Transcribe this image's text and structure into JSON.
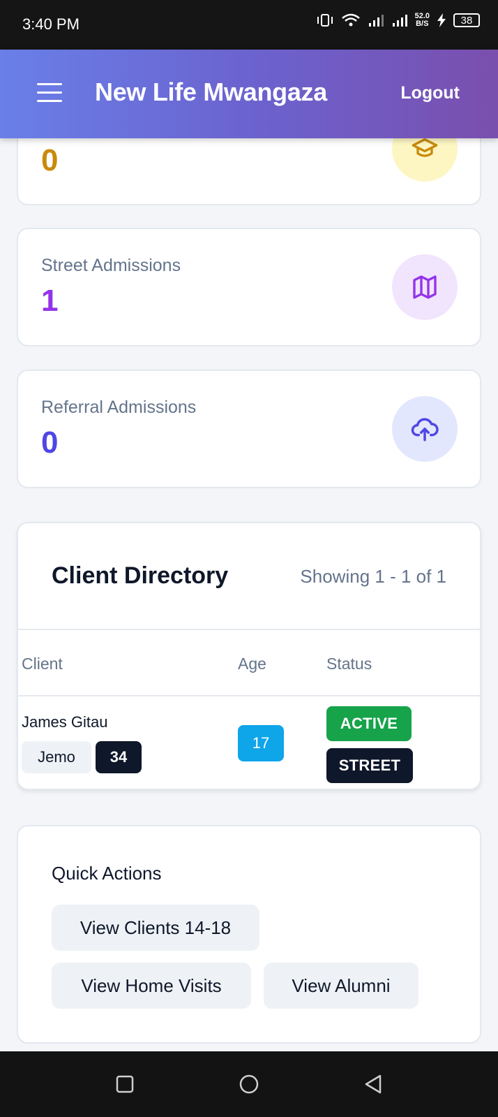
{
  "status_bar": {
    "time": "3:40 PM",
    "net_speed_value": "52.0",
    "net_speed_unit": "B/S",
    "battery": "38"
  },
  "header": {
    "title": "New Life Mwangaza",
    "logout_label": "Logout"
  },
  "stats": {
    "top_partial_value": "0",
    "street": {
      "label": "Street Admissions",
      "value": "1",
      "icon": "map-icon"
    },
    "referral": {
      "label": "Referral Admissions",
      "value": "0",
      "icon": "cloud-upload-icon"
    },
    "top_partial_icon": "graduation-cap-icon"
  },
  "directory": {
    "title": "Client Directory",
    "showing": "Showing 1 - 1 of 1",
    "columns": [
      "Client",
      "Age",
      "Status"
    ],
    "rows": [
      {
        "name": "James Gitau",
        "tag": "Jemo",
        "number": "34",
        "age": "17",
        "status": "ACTIVE",
        "type": "STREET"
      }
    ]
  },
  "quick_actions": {
    "title": "Quick Actions",
    "buttons": [
      "View Clients 14-18",
      "View Home Visits",
      "View Alumni"
    ]
  },
  "colors": {
    "accent_gold": "#c98a0b",
    "accent_purple": "#9333ea",
    "accent_indigo": "#4f46e5",
    "active_green": "#16a34a",
    "age_blue": "#0ea5e9",
    "dark_badge": "#0f172a"
  }
}
